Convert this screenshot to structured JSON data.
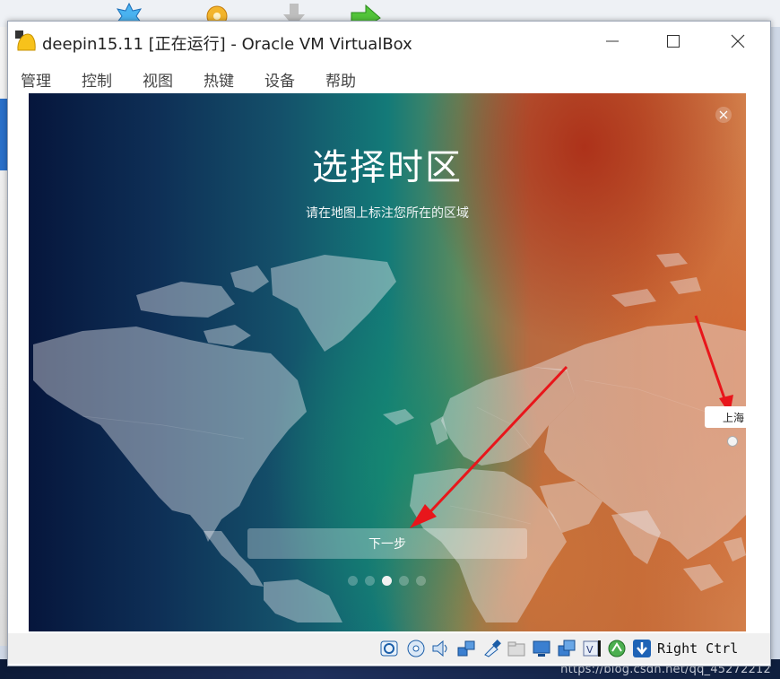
{
  "window": {
    "title": "deepin15.11 [正在运行] - Oracle VM VirtualBox",
    "controls": {
      "minimize": "minimize",
      "maximize": "maximize",
      "close": "close"
    }
  },
  "menu": [
    "管理",
    "控制",
    "视图",
    "热键",
    "设备",
    "帮助"
  ],
  "guest": {
    "title": "选择时区",
    "subtitle": "请在地图上标注您所在的区域",
    "selected_city": "上海",
    "next_button": "下一步",
    "pager": {
      "total": 5,
      "current": 3
    },
    "colors": {
      "arrow": "#e8161b",
      "overlay_button": "rgba(255,255,255,0.3)"
    }
  },
  "statusbar": {
    "icons": [
      "hard-disk-icon",
      "optical-disk-icon",
      "audio-icon",
      "network-icon",
      "usb-icon",
      "shared-folder-icon",
      "display-icon",
      "snapshot-icon",
      "recording-icon",
      "cpu-icon",
      "mouse-integration-icon",
      "keyboard-capture-icon"
    ],
    "host_key": "Right Ctrl"
  },
  "watermark": "https://blog.csdn.net/qq_45272212"
}
